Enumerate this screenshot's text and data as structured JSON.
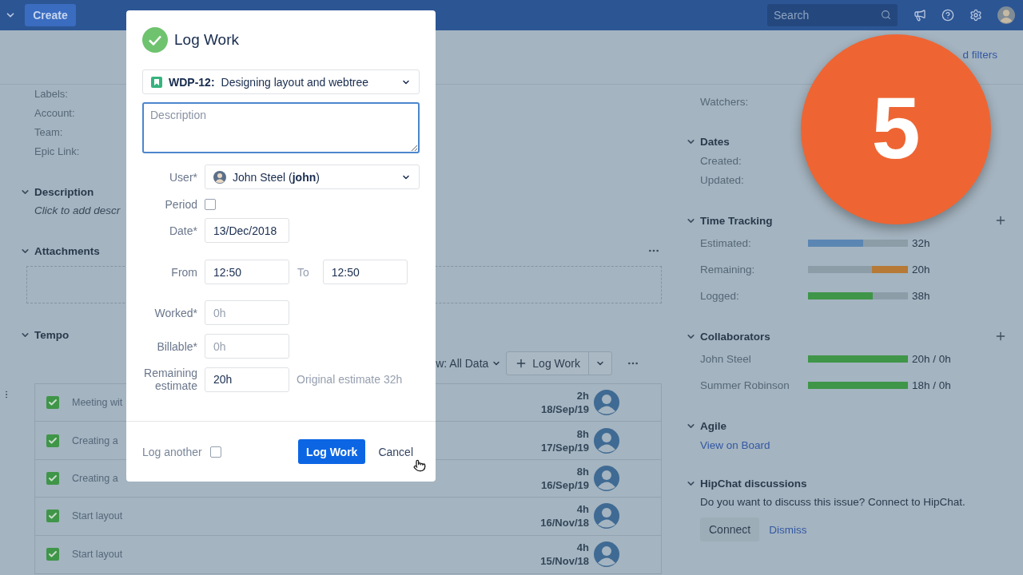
{
  "top_bar": {
    "create": "Create",
    "search": {
      "placeholder": "Search"
    }
  },
  "page_header": {
    "link": "d filters"
  },
  "issue_fields": [
    {
      "label": "Labels:"
    },
    {
      "label": "Account:"
    },
    {
      "label": "Team:"
    },
    {
      "label": "Epic Link:"
    }
  ],
  "description_section": {
    "title": "Description",
    "prompt": "Click to add descr"
  },
  "attachments_section": {
    "title": "Attachments"
  },
  "tempo": {
    "title": "Tempo",
    "view_filter": "w: All Data",
    "log_work_button": "Log Work",
    "worklogs": [
      {
        "text": "Meeting wit",
        "checked": true,
        "hours": "2h",
        "date": "18/Sep/19"
      },
      {
        "text": "Creating a",
        "checked": true,
        "hours": "8h",
        "date": "17/Sep/19"
      },
      {
        "text": "Creating a",
        "checked": true,
        "hours": "8h",
        "date": "16/Sep/19"
      },
      {
        "text": "Start layout",
        "checked": true,
        "hours": "4h",
        "date": "16/Nov/18"
      },
      {
        "text": "Start layout",
        "checked": true,
        "hours": "4h",
        "date": "15/Nov/18"
      }
    ]
  },
  "sidebar": {
    "watchers_label": "Watchers:",
    "dates": {
      "title": "Dates",
      "rows": [
        {
          "label": "Created:"
        },
        {
          "label": "Updated:"
        }
      ]
    },
    "time_tracking": {
      "title": "Time Tracking",
      "rows": [
        {
          "label": "Estimated:",
          "color": "#5b86b3",
          "level": 0.55,
          "from_end": false,
          "value": "32h"
        },
        {
          "label": "Remaining:",
          "color": "#b67a36",
          "level": 0.36,
          "from_end": true,
          "value": "20h"
        },
        {
          "label": "Logged:",
          "color": "#3f9548",
          "level": 0.65,
          "from_end": false,
          "value": "38h"
        }
      ]
    },
    "collaborators": {
      "title": "Collaborators",
      "rows": [
        {
          "label": "John Steel",
          "color": "#3f9548",
          "level": 1,
          "value": "20h / 0h"
        },
        {
          "label": "Summer Robinson",
          "color": "#3f9548",
          "level": 1,
          "value": "18h / 0h"
        }
      ]
    },
    "agile": {
      "title": "Agile",
      "link": "View on Board"
    },
    "hipchat": {
      "title": "HipChat discussions",
      "text": "Do you want to discuss this issue? Connect to HipChat.",
      "connect": "Connect",
      "dismiss": "Dismiss"
    }
  },
  "dialog": {
    "title": "Log Work",
    "issue": {
      "key": "WDP-12:",
      "summary": "Designing layout and webtree"
    },
    "description": {
      "placeholder": "Description"
    },
    "user": {
      "label": "User*",
      "value": "John Steel (**john**)"
    },
    "period": {
      "label": "Period",
      "checked": false
    },
    "date": {
      "label": "Date*",
      "value": "13/Dec/2018"
    },
    "from": {
      "label": "From",
      "value": "12:50"
    },
    "to": {
      "label": "To",
      "value": "12:50"
    },
    "worked": {
      "label": "Worked*",
      "placeholder": "0h"
    },
    "billable": {
      "label": "Billable*",
      "placeholder": "0h"
    },
    "remaining": {
      "label": "Remaining estimate",
      "value": "20h",
      "hint": "Original estimate 32h"
    },
    "log_another": {
      "label": "Log another",
      "checked": false
    },
    "submit": "Log Work",
    "cancel": "Cancel"
  },
  "badge": "5"
}
